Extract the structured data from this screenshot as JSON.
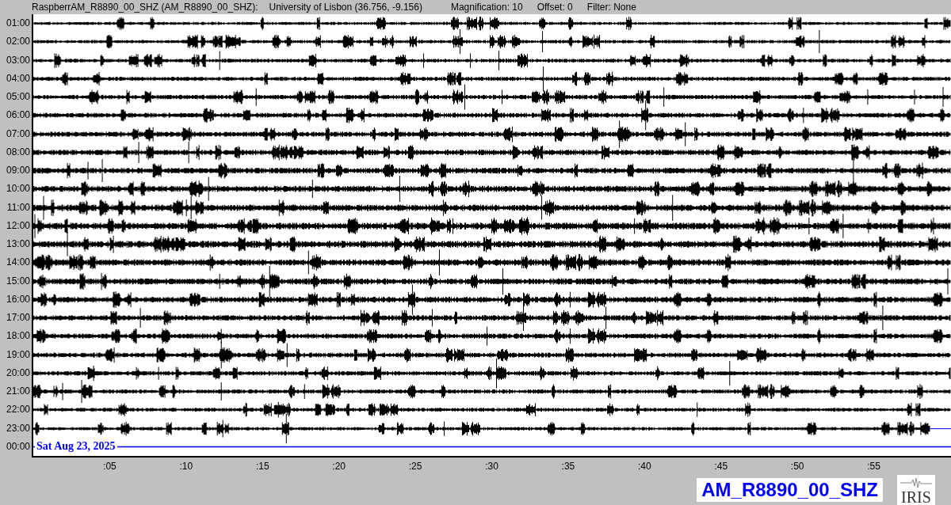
{
  "header": {
    "station": "RaspberrAM_R8890_00_SHZ (AM_R8890_00_SHZ):",
    "location": "University of Lisbon (36.756, -9.156)",
    "magnification": "Magnification: 10",
    "offset": "Offset: 0",
    "filter": "Filter: None"
  },
  "rows": [
    {
      "time": "01:00",
      "kind": "trace"
    },
    {
      "time": "02:00",
      "kind": "trace"
    },
    {
      "time": "03:00",
      "kind": "trace"
    },
    {
      "time": "04:00",
      "kind": "trace"
    },
    {
      "time": "05:00",
      "kind": "trace"
    },
    {
      "time": "06:00",
      "kind": "trace"
    },
    {
      "time": "07:00",
      "kind": "trace"
    },
    {
      "time": "08:00",
      "kind": "trace"
    },
    {
      "time": "09:00",
      "kind": "trace"
    },
    {
      "time": "10:00",
      "kind": "trace"
    },
    {
      "time": "11:00",
      "kind": "trace"
    },
    {
      "time": "12:00",
      "kind": "trace"
    },
    {
      "time": "13:00",
      "kind": "trace"
    },
    {
      "time": "14:00",
      "kind": "trace"
    },
    {
      "time": "15:00",
      "kind": "trace"
    },
    {
      "time": "16:00",
      "kind": "trace"
    },
    {
      "time": "17:00",
      "kind": "trace"
    },
    {
      "time": "18:00",
      "kind": "trace"
    },
    {
      "time": "19:00",
      "kind": "trace"
    },
    {
      "time": "20:00",
      "kind": "trace"
    },
    {
      "time": "21:00",
      "kind": "trace"
    },
    {
      "time": "22:00",
      "kind": "trace"
    },
    {
      "time": "23:00",
      "kind": "partial"
    },
    {
      "time": "00:00",
      "kind": "marker",
      "date": "Sat Aug 23, 2025"
    }
  ],
  "x_ticks": [
    ":05",
    ":10",
    ":15",
    ":20",
    ":25",
    ":30",
    ":35",
    ":40",
    ":45",
    ":50",
    ":55"
  ],
  "station_badge": "AM_R8890_00_SHZ",
  "logo": {
    "text": "IRIS"
  }
}
